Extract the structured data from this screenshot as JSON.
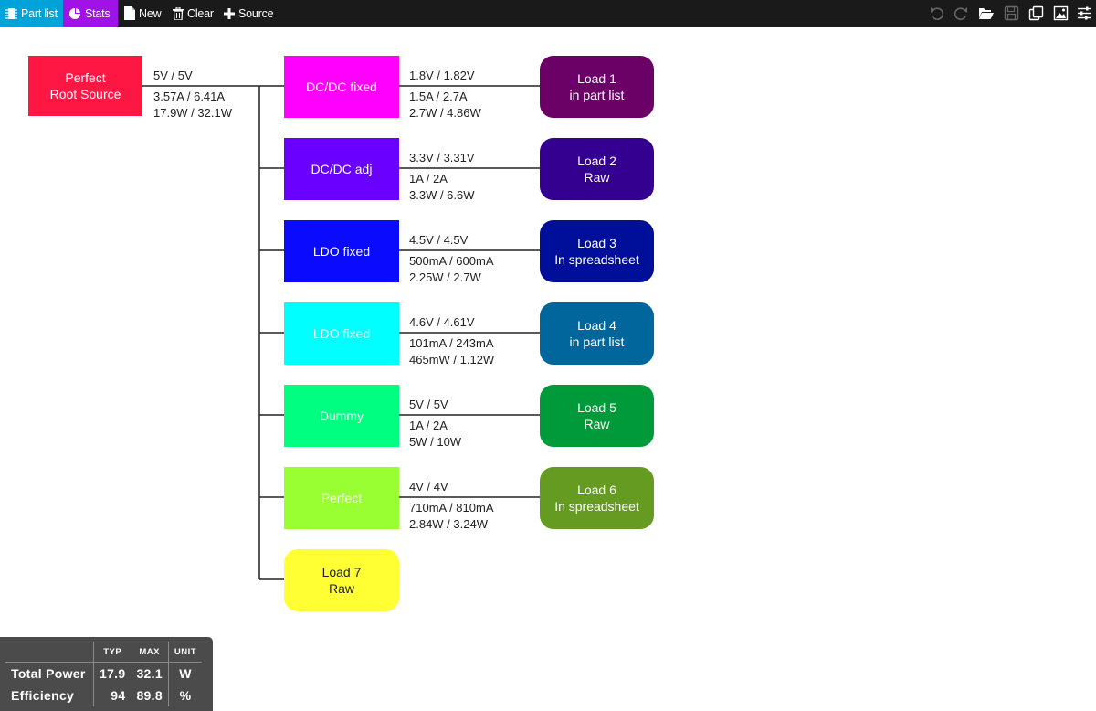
{
  "toolbar": {
    "part_list": "Part list",
    "stats": "Stats",
    "new": "New",
    "clear": "Clear",
    "source": "Source",
    "right_icons": [
      "undo-icon",
      "redo-icon",
      "folder-open-icon",
      "save-icon",
      "copy-icon",
      "image-icon",
      "sliders-icon"
    ]
  },
  "colors": {
    "toolbar_bg": "#1a1a1a",
    "part_list_bg": "#00a3d9",
    "stats_bg": "#a112e6",
    "wire": "#222222",
    "stats_panel_bg": "#4b4b4b"
  },
  "root": {
    "line1": "Perfect",
    "line2": "Root Source",
    "color": "#ff1744",
    "voltage": "5V / 5V",
    "current": "3.57A / 6.41A",
    "power": "17.9W / 32.1W"
  },
  "branches": [
    {
      "converter": {
        "line1": "DC/DC fixed",
        "color": "#ff00ff"
      },
      "voltage": "1.8V / 1.82V",
      "current": "1.5A / 2.7A",
      "power": "2.7W / 4.86W",
      "load": {
        "line1": "Load 1",
        "line2": "in part list",
        "color": "#6b0066"
      }
    },
    {
      "converter": {
        "line1": "DC/DC adj",
        "color": "#6a00ff"
      },
      "voltage": "3.3V / 3.31V",
      "current": "1A / 2A",
      "power": "3.3W / 6.6W",
      "load": {
        "line1": "Load 2",
        "line2": "Raw",
        "color": "#33008f"
      }
    },
    {
      "converter": {
        "line1": "LDO fixed",
        "color": "#0a0aff"
      },
      "voltage": "4.5V / 4.5V",
      "current": "500mA / 600mA",
      "power": "2.25W / 2.7W",
      "load": {
        "line1": "Load 3",
        "line2": "In spreadsheet",
        "color": "#000f99"
      }
    },
    {
      "converter": {
        "line1": "LDO fixed",
        "color": "#00ffff"
      },
      "voltage": "4.6V / 4.61V",
      "current": "101mA / 243mA",
      "power": "465mW / 1.12W",
      "load": {
        "line1": "Load 4",
        "line2": "in part list",
        "color": "#00669b"
      }
    },
    {
      "converter": {
        "line1": "Dummy",
        "color": "#00ff80"
      },
      "voltage": "5V / 5V",
      "current": "1A / 2A",
      "power": "5W / 10W",
      "load": {
        "line1": "Load 5",
        "line2": "Raw",
        "color": "#009a3a"
      }
    },
    {
      "converter": {
        "line1": "Perfect",
        "color": "#99ff33"
      },
      "voltage": "4V / 4V",
      "current": "710mA / 810mA",
      "power": "2.84W / 3.24W",
      "load": {
        "line1": "Load 6",
        "line2": "In spreadsheet",
        "color": "#669b22"
      }
    }
  ],
  "direct_load": {
    "line1": "Load 7",
    "line2": "Raw",
    "color": "#ffff33",
    "text_color": "#222222"
  },
  "stats": {
    "headers": [
      "TYP",
      "MAX",
      "UNIT"
    ],
    "rows": [
      {
        "name": "Total Power",
        "typ": "17.9",
        "max": "32.1",
        "unit": "W"
      },
      {
        "name": "Efficiency",
        "typ": "94",
        "max": "89.8",
        "unit": "%"
      }
    ]
  }
}
